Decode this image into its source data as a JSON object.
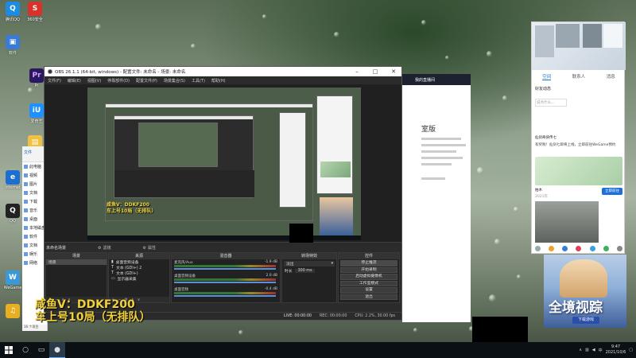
{
  "desktop": {
    "icons": [
      {
        "label": "360安全",
        "color": "#d8322a",
        "glyph": "S"
      },
      {
        "label": "腾讯QQ",
        "color": "#1c8be0",
        "glyph": "Q"
      },
      {
        "label": "软件",
        "color": "#3a7bd5",
        "glyph": "▣"
      },
      {
        "label": "Pr",
        "color": "#2a1860",
        "glyph": "Pr"
      },
      {
        "label": "爱奇艺",
        "color": "#1e90ff",
        "glyph": "iU"
      },
      {
        "label": "文件",
        "color": "#f0c040",
        "glyph": "▤"
      },
      {
        "label": "Internet",
        "color": "#1c6fd0",
        "glyph": "e"
      },
      {
        "label": "QQ",
        "color": "#222222",
        "glyph": "Q"
      },
      {
        "label": "WeGame",
        "color": "#3a9ad9",
        "glyph": "W"
      },
      {
        "label": "",
        "color": "#e8b020",
        "glyph": "♫"
      }
    ]
  },
  "explorer": {
    "title": "文件",
    "nav": [
      "此电脑",
      "视频",
      "图片",
      "文档",
      "下载",
      "音乐",
      "桌面",
      "本地磁盘",
      "软件",
      "文档",
      "娱乐",
      "网络"
    ],
    "status": "16 个项目"
  },
  "obs": {
    "title": "OBS 26.1.1 (64-bit, windows) - 配置文件: 未命名 - 场景: 未命名",
    "menu": [
      "文件(F)",
      "编辑(E)",
      "视图(V)",
      "停靠部件(D)",
      "配置文件(P)",
      "场景集合(S)",
      "工具(T)",
      "帮助(H)"
    ],
    "canvas_text": [
      "咸鱼V：DDKF200",
      "车上号10局（无排队）"
    ],
    "dock": {
      "scene_tag": "未命名场景",
      "scene_buttons": [
        "滤镜",
        "属性"
      ],
      "panels": {
        "scenes": {
          "title": "场景",
          "items": [
            "场景"
          ]
        },
        "sources": {
          "title": "来源",
          "items": [
            "桌面音频设备",
            "文本 (GDI+) 2",
            "文本 (GDI+)",
            "显示器采集"
          ]
        },
        "mixer": {
          "title": "混音器",
          "channels": [
            {
              "name": "麦克风/Aux",
              "db": "-1.9 dB"
            },
            {
              "name": "桌面音频设备",
              "db": "2.0 dB"
            },
            {
              "name": "桌面音频",
              "db": "-0.4 dB"
            }
          ]
        },
        "transitions": {
          "title": "转场特效",
          "type": "淡出",
          "duration_label": "时长",
          "duration": "300 ms"
        },
        "controls": {
          "title": "控件",
          "buttons": [
            "停止推流",
            "开始录制",
            "启动虚拟摄像机",
            "工作室模式",
            "设置",
            "退出"
          ]
        }
      }
    },
    "status": {
      "live": "LIVE: 00:00:00",
      "rec": "REC: 00:00:00",
      "cpu": "CPU: 2.2%, 30.00 fps"
    }
  },
  "bg_window": {
    "header": "我的直播间",
    "heading": "室版"
  },
  "chat": {
    "tabs": [
      "空间",
      "联系人",
      "消息"
    ],
    "active_tab": "空间",
    "section": "好友动态",
    "input_placeholder": "说点什么...",
    "post_user": "仙剑奇侠传七",
    "post_text": "有奖啦！仙剑七即将上线，立即前往WeGame预约",
    "share": "立即前往",
    "comment_user": "柏木",
    "comment_date": "2021年"
  },
  "ad": {
    "game_title": "全境视踪",
    "download": "下载游戏"
  },
  "taskbar": {
    "time": "9:47",
    "date": "2021/10/6",
    "lang": "中"
  }
}
